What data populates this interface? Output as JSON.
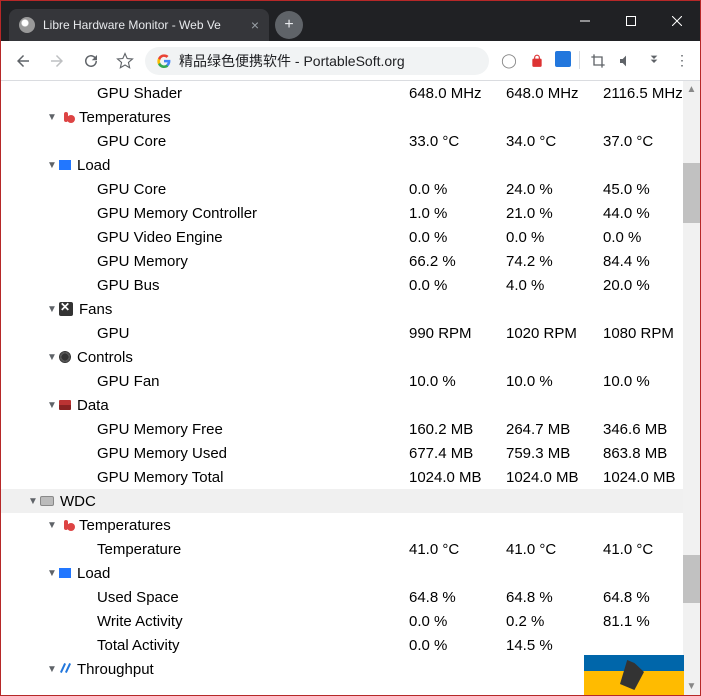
{
  "window": {
    "tab_title": "Libre Hardware Monitor - Web Ve",
    "address": "精品绿色便携软件 - PortableSoft.org"
  },
  "rows": [
    {
      "indent": 4,
      "chev": "",
      "icon": "",
      "label": "GPU Shader",
      "v1": "648.0 MHz",
      "v2": "648.0 MHz",
      "v3": "2116.5 MHz"
    },
    {
      "indent": 2,
      "chev": "▼",
      "icon": "thermo",
      "label": "Temperatures",
      "v1": "",
      "v2": "",
      "v3": ""
    },
    {
      "indent": 4,
      "chev": "",
      "icon": "",
      "label": "GPU Core",
      "v1": "33.0 °C",
      "v2": "34.0 °C",
      "v3": "37.0 °C"
    },
    {
      "indent": 2,
      "chev": "▼",
      "icon": "load",
      "label": "Load",
      "v1": "",
      "v2": "",
      "v3": ""
    },
    {
      "indent": 4,
      "chev": "",
      "icon": "",
      "label": "GPU Core",
      "v1": "0.0 %",
      "v2": "24.0 %",
      "v3": "45.0 %"
    },
    {
      "indent": 4,
      "chev": "",
      "icon": "",
      "label": "GPU Memory Controller",
      "v1": "1.0 %",
      "v2": "21.0 %",
      "v3": "44.0 %"
    },
    {
      "indent": 4,
      "chev": "",
      "icon": "",
      "label": "GPU Video Engine",
      "v1": "0.0 %",
      "v2": "0.0 %",
      "v3": "0.0 %"
    },
    {
      "indent": 4,
      "chev": "",
      "icon": "",
      "label": "GPU Memory",
      "v1": "66.2 %",
      "v2": "74.2 %",
      "v3": "84.4 %"
    },
    {
      "indent": 4,
      "chev": "",
      "icon": "",
      "label": "GPU Bus",
      "v1": "0.0 %",
      "v2": "4.0 %",
      "v3": "20.0 %"
    },
    {
      "indent": 2,
      "chev": "▼",
      "icon": "fan",
      "label": "Fans",
      "v1": "",
      "v2": "",
      "v3": ""
    },
    {
      "indent": 4,
      "chev": "",
      "icon": "",
      "label": "GPU",
      "v1": "990 RPM",
      "v2": "1020 RPM",
      "v3": "1080 RPM"
    },
    {
      "indent": 2,
      "chev": "▼",
      "icon": "control",
      "label": "Controls",
      "v1": "",
      "v2": "",
      "v3": ""
    },
    {
      "indent": 4,
      "chev": "",
      "icon": "",
      "label": "GPU Fan",
      "v1": "10.0 %",
      "v2": "10.0 %",
      "v3": "10.0 %"
    },
    {
      "indent": 2,
      "chev": "▼",
      "icon": "data",
      "label": "Data",
      "v1": "",
      "v2": "",
      "v3": ""
    },
    {
      "indent": 4,
      "chev": "",
      "icon": "",
      "label": "GPU Memory Free",
      "v1": "160.2 MB",
      "v2": "264.7 MB",
      "v3": "346.6 MB"
    },
    {
      "indent": 4,
      "chev": "",
      "icon": "",
      "label": "GPU Memory Used",
      "v1": "677.4 MB",
      "v2": "759.3 MB",
      "v3": "863.8 MB"
    },
    {
      "indent": 4,
      "chev": "",
      "icon": "",
      "label": "GPU Memory Total",
      "v1": "1024.0 MB",
      "v2": "1024.0 MB",
      "v3": "1024.0 MB"
    },
    {
      "indent": 1,
      "chev": "▼",
      "icon": "hdd",
      "label": "WDC",
      "v1": "",
      "v2": "",
      "v3": "",
      "selected": true
    },
    {
      "indent": 2,
      "chev": "▼",
      "icon": "thermo",
      "label": "Temperatures",
      "v1": "",
      "v2": "",
      "v3": ""
    },
    {
      "indent": 4,
      "chev": "",
      "icon": "",
      "label": "Temperature",
      "v1": "41.0 °C",
      "v2": "41.0 °C",
      "v3": "41.0 °C"
    },
    {
      "indent": 2,
      "chev": "▼",
      "icon": "load",
      "label": "Load",
      "v1": "",
      "v2": "",
      "v3": ""
    },
    {
      "indent": 4,
      "chev": "",
      "icon": "",
      "label": "Used Space",
      "v1": "64.8 %",
      "v2": "64.8 %",
      "v3": "64.8 %"
    },
    {
      "indent": 4,
      "chev": "",
      "icon": "",
      "label": "Write Activity",
      "v1": "0.0 %",
      "v2": "0.2 %",
      "v3": "81.1 %"
    },
    {
      "indent": 4,
      "chev": "",
      "icon": "",
      "label": "Total Activity",
      "v1": "0.0 %",
      "v2": "14.5 %",
      "v3": ""
    },
    {
      "indent": 2,
      "chev": "▼",
      "icon": "thru",
      "label": "Throughput",
      "v1": "",
      "v2": "",
      "v3": ""
    }
  ]
}
